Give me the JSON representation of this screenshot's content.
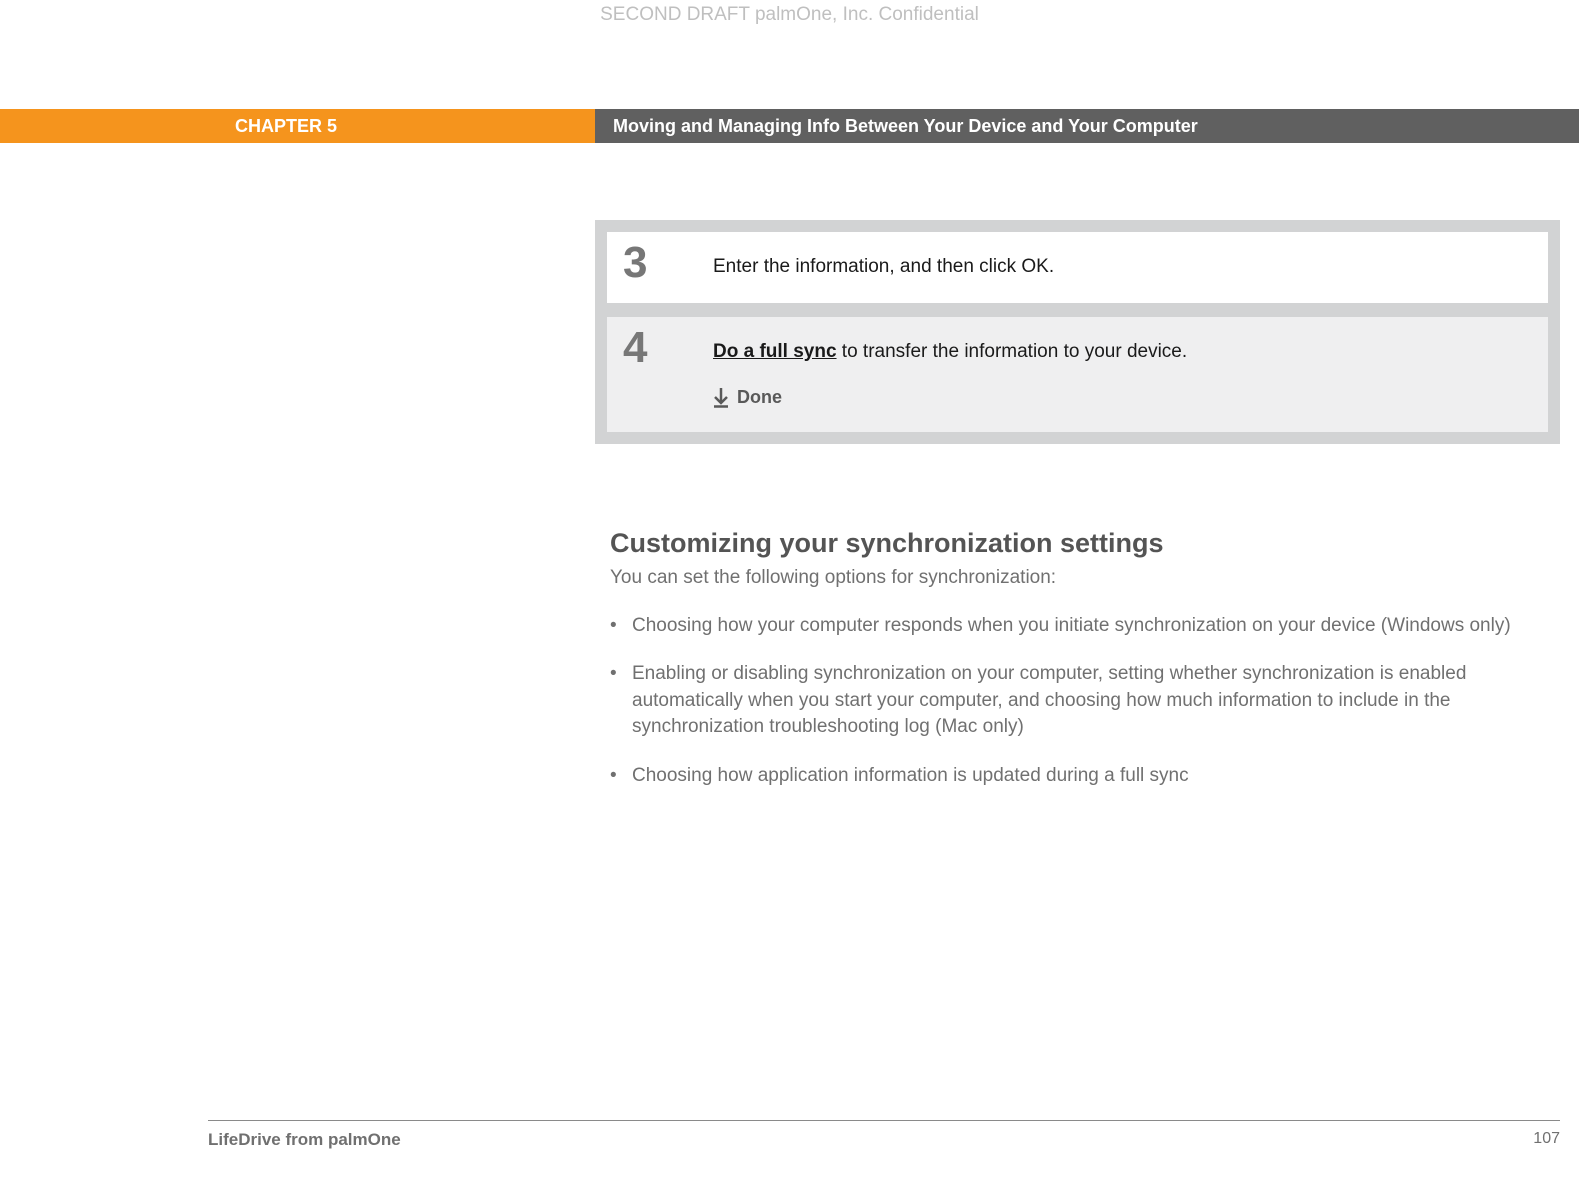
{
  "draft_header": "SECOND DRAFT palmOne, Inc.  Confidential",
  "chapter": {
    "left": "CHAPTER 5",
    "right": "Moving and Managing Info Between Your Device and Your Computer"
  },
  "steps": {
    "s3": {
      "num": "3",
      "text": "Enter the information, and then click OK."
    },
    "s4": {
      "num": "4",
      "link": "Do a full sync",
      "text_rest": " to transfer the information to your device.",
      "done": "Done"
    }
  },
  "section": {
    "heading": "Customizing your synchronization settings",
    "intro": "You can set the following options for synchronization:",
    "bullets": {
      "b1": "Choosing how your computer responds when you initiate synchronization on your device (Windows only)",
      "b2": "Enabling or disabling synchronization on your computer, setting whether synchronization is enabled automatically when you start your computer, and choosing how much information to include in the synchronization troubleshooting log (Mac only)",
      "b3": "Choosing how application information is updated during a full sync"
    }
  },
  "footer": {
    "left": "LifeDrive from palmOne",
    "right": "107"
  }
}
